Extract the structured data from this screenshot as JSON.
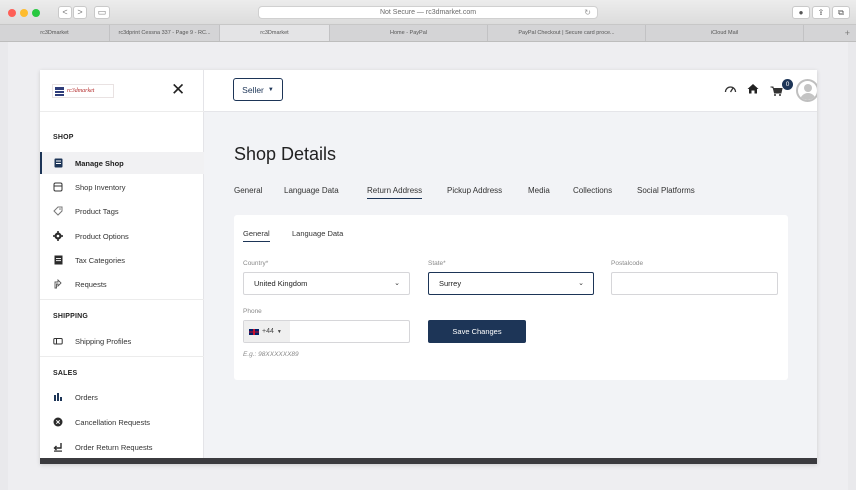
{
  "browser": {
    "address": "Not Secure — rc3dmarket.com",
    "nav_back": "<",
    "nav_forward": ">",
    "sidebar_toggle": "▭",
    "reload": "↻",
    "tabs": [
      "rc3Dmarket",
      "rc3dprint Cessna 337 - Page 9 - RC...",
      "rc3Dmarket",
      "Home - PayPal",
      "PayPal Checkout | Secure card proce...",
      "iCloud Mail"
    ],
    "new_tab": "+"
  },
  "header": {
    "seller_label": "Seller",
    "cart_count": "0"
  },
  "sidebar": {
    "logo_text": "rc3dmarket",
    "close_glyph": "✕",
    "sections": [
      {
        "label": "SHOP",
        "items": [
          "Manage Shop",
          "Shop Inventory",
          "Product Tags",
          "Product Options",
          "Tax Categories",
          "Requests"
        ]
      },
      {
        "label": "SHIPPING",
        "items": [
          "Shipping Profiles"
        ]
      },
      {
        "label": "SALES",
        "items": [
          "Orders",
          "Cancellation Requests",
          "Order Return Requests"
        ]
      }
    ],
    "icons": [
      "store-icon",
      "box-icon",
      "tag-icon",
      "gear-icon",
      "file-icon",
      "request-icon",
      "truck-icon",
      "bar-chart-icon",
      "cancel-icon",
      "return-icon"
    ]
  },
  "main": {
    "title": "Shop Details",
    "tabs": [
      "General",
      "Language Data",
      "Return Address",
      "Pickup Address",
      "Media",
      "Collections",
      "Social Platforms"
    ],
    "active_tab": "Return Address",
    "sub_tabs": [
      "General",
      "Language Data"
    ],
    "form": {
      "country_label": "Country*",
      "country_value": "United Kingdom",
      "state_label": "State*",
      "state_value": "Surrey",
      "postalcode_label": "Postalcode",
      "postalcode_value": "",
      "phone_label": "Phone",
      "dial_code": "+44",
      "phone_value": "",
      "phone_hint": "E.g.: 98XXXXXX89",
      "save_label": "Save Changes"
    }
  },
  "colors": {
    "primary": "#1d3557",
    "traffic_red": "#fe5f57",
    "traffic_yellow": "#febc2e",
    "traffic_green": "#28c840"
  }
}
